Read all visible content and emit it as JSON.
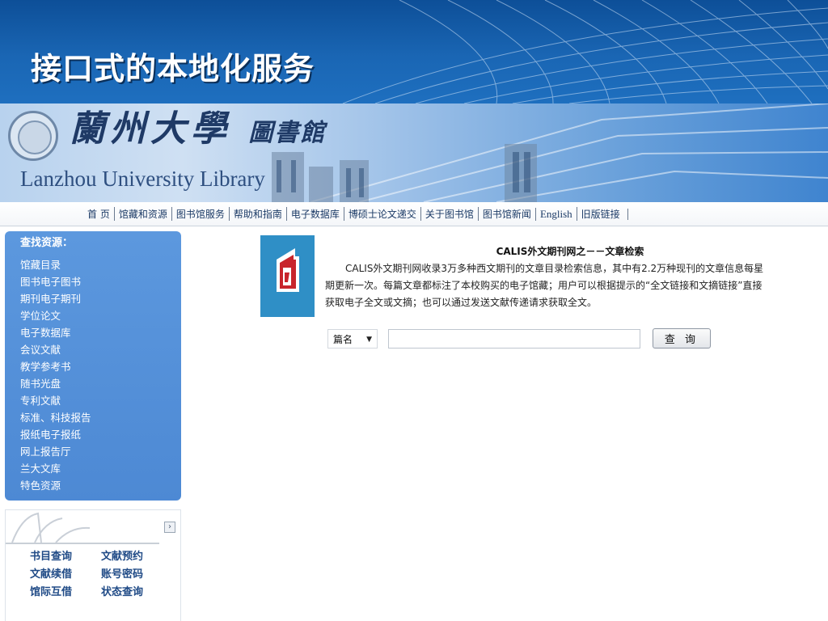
{
  "slide": {
    "title": "接口式的本地化服务"
  },
  "banner": {
    "name_cn": "蘭州大學",
    "name_cn_suffix": "圖書館",
    "name_en": "Lanzhou University Library"
  },
  "nav": {
    "items": [
      "首 页",
      "馆藏和资源",
      "图书馆服务",
      "帮助和指南",
      "电子数据库",
      "博硕士论文递交",
      "关于图书馆",
      "图书馆新闻",
      "English",
      "旧版链接"
    ]
  },
  "resources": {
    "heading": "查找资源：",
    "items": [
      "馆藏目录",
      "图书电子图书",
      "期刊电子期刊",
      "学位论文",
      "电子数据库",
      "会议文献",
      "教学参考书",
      "随书光盘",
      "专利文献",
      "标准、科技报告",
      "报纸电子报纸",
      "网上报告厅",
      "兰大文库",
      "特色资源"
    ]
  },
  "circulation": {
    "arrow": "›",
    "links": [
      "书目查询",
      "文献预约",
      "文献续借",
      "账号密码",
      "馆际互借",
      "状态查询"
    ]
  },
  "calis": {
    "title": "CALIS外文期刊网之－－文章检索",
    "description": "CALIS外文期刊网收录3万多种西文期刊的文章目录检索信息，其中有2.2万种现刊的文章信息每星期更新一次。每篇文章都标注了本校购买的电子馆藏；用户可以根据提示的“全文链接和文摘链接”直接获取电子全文或文摘；也可以通过发送文献传递请求获取全文。",
    "search": {
      "field_selected": "篇名",
      "input_value": "",
      "button_label": "查 询"
    }
  },
  "colors": {
    "title_band": "#1a66b4",
    "panel_blue": "#4d89d4",
    "logo_red": "#c8252c",
    "logo_teal": "#2f8fc6"
  }
}
